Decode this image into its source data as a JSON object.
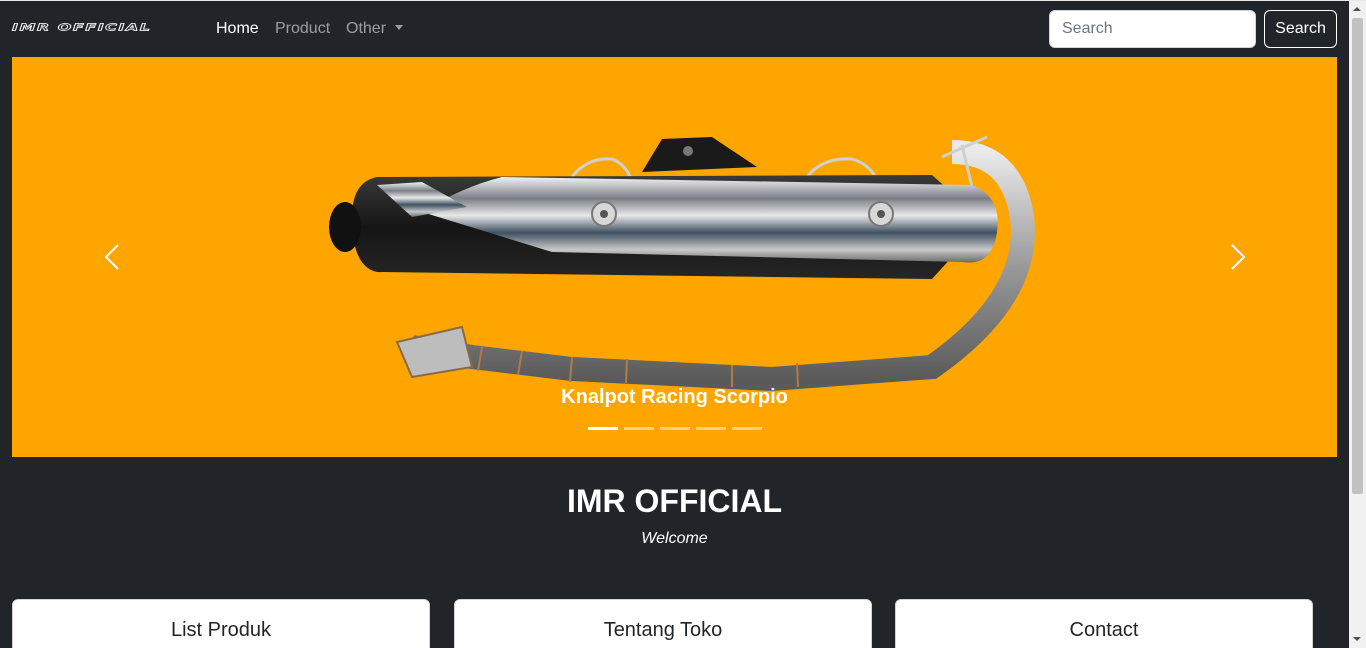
{
  "navbar": {
    "brand": "IMR OFFICIAL",
    "links": [
      {
        "label": "Home",
        "active": true
      },
      {
        "label": "Product",
        "active": false
      },
      {
        "label": "Other",
        "active": false,
        "dropdown": true
      }
    ],
    "search": {
      "placeholder": "Search",
      "value": "",
      "button_label": "Search"
    }
  },
  "carousel": {
    "caption": "Knalpot Racing Scorpio",
    "slide_count": 5,
    "active_slide": 1,
    "background_color": "#ffa500",
    "prev_icon": "chevron-left-icon",
    "next_icon": "chevron-right-icon"
  },
  "hero": {
    "title": "IMR OFFICIAL",
    "subtitle": "Welcome"
  },
  "cards": [
    {
      "title": "List Produk"
    },
    {
      "title": "Tentang Toko"
    },
    {
      "title": "Contact"
    }
  ],
  "colors": {
    "page_background": "#212529",
    "carousel_background": "#ffa500",
    "text": "#ffffff"
  }
}
